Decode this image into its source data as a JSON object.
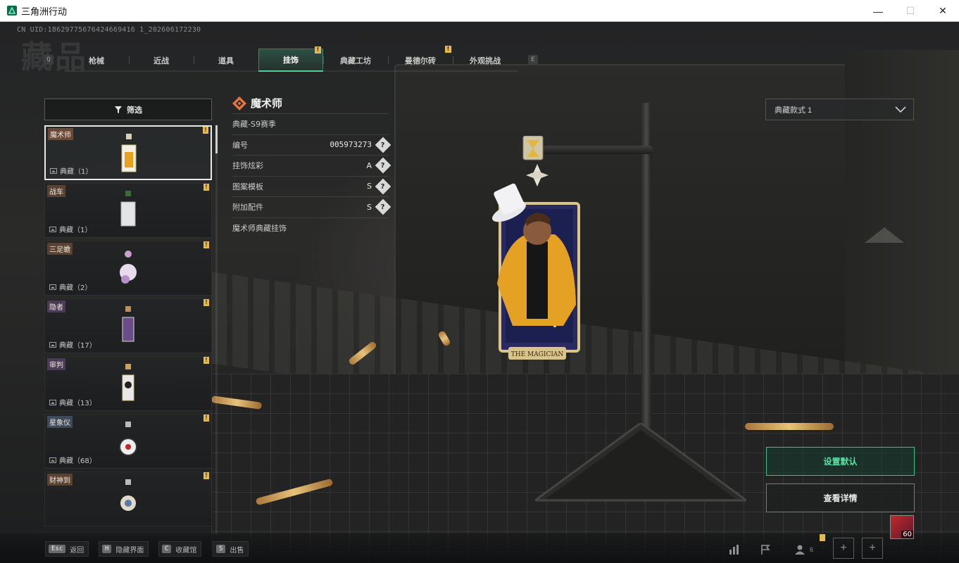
{
  "window": {
    "title": "三角洲行动",
    "minimize": "—",
    "maximize": "☐",
    "close": "✕"
  },
  "uid_text": "CN UID:18629775676424669416 1_202606172230",
  "page_title_watermark": "藏品",
  "tabs": {
    "left_key": "Q",
    "right_key": "E",
    "items": [
      {
        "label": "枪械",
        "active": false,
        "badge": ""
      },
      {
        "label": "近战",
        "active": false,
        "badge": ""
      },
      {
        "label": "道具",
        "active": false,
        "badge": ""
      },
      {
        "label": "挂饰",
        "active": true,
        "badge": "!"
      },
      {
        "label": "典藏工坊",
        "active": false,
        "badge": ""
      },
      {
        "label": "曼德尔砖",
        "active": false,
        "badge": "!"
      },
      {
        "label": "外观挑战",
        "active": false,
        "badge": ""
      }
    ]
  },
  "filter": {
    "label": "筛选"
  },
  "list": {
    "items": [
      {
        "name": "魔术师",
        "count": "典藏（1）",
        "badge": "!",
        "selected": true
      },
      {
        "name": "战车",
        "count": "典藏（1）",
        "badge": "!",
        "selected": false
      },
      {
        "name": "三足蟾",
        "count": "典藏（2）",
        "badge": "!",
        "selected": false
      },
      {
        "name": "隐者",
        "count": "典藏（17）",
        "badge": "!",
        "selected": false
      },
      {
        "name": "审判",
        "count": "典藏（13）",
        "badge": "!",
        "selected": false
      },
      {
        "name": "星象仪",
        "count": "典藏（68）",
        "badge": "!",
        "selected": false
      },
      {
        "name": "财神到",
        "count": "",
        "badge": "!",
        "selected": false
      }
    ]
  },
  "detail": {
    "name": "魔术师",
    "season": "典藏-S9赛季",
    "rows": [
      {
        "label": "编号",
        "value": "005973273",
        "help": "?"
      },
      {
        "label": "挂饰炫彩",
        "value": "A",
        "help": "?"
      },
      {
        "label": "图案模板",
        "value": "S",
        "help": "?"
      },
      {
        "label": "附加配件",
        "value": "S",
        "help": "?"
      }
    ],
    "description": "魔术师典藏挂饰"
  },
  "style_select": {
    "value": "典藏款式 1"
  },
  "charm_art": {
    "caption": "THE MAGICIAN"
  },
  "actions": {
    "set_default": "设置默认",
    "view_details": "查看详情"
  },
  "bottom_hints": [
    {
      "key": "Esc",
      "label": "返回"
    },
    {
      "key": "H",
      "label": "隐藏界面"
    },
    {
      "key": "C",
      "label": "收藏馆"
    },
    {
      "key": "S",
      "label": "出售"
    }
  ],
  "bottom_bar": {
    "friends_count": "6",
    "plus": "+",
    "avatar_level": "60"
  },
  "colors": {
    "accent_green": "#4cd39a",
    "badge_yellow": "#e6b94c"
  }
}
